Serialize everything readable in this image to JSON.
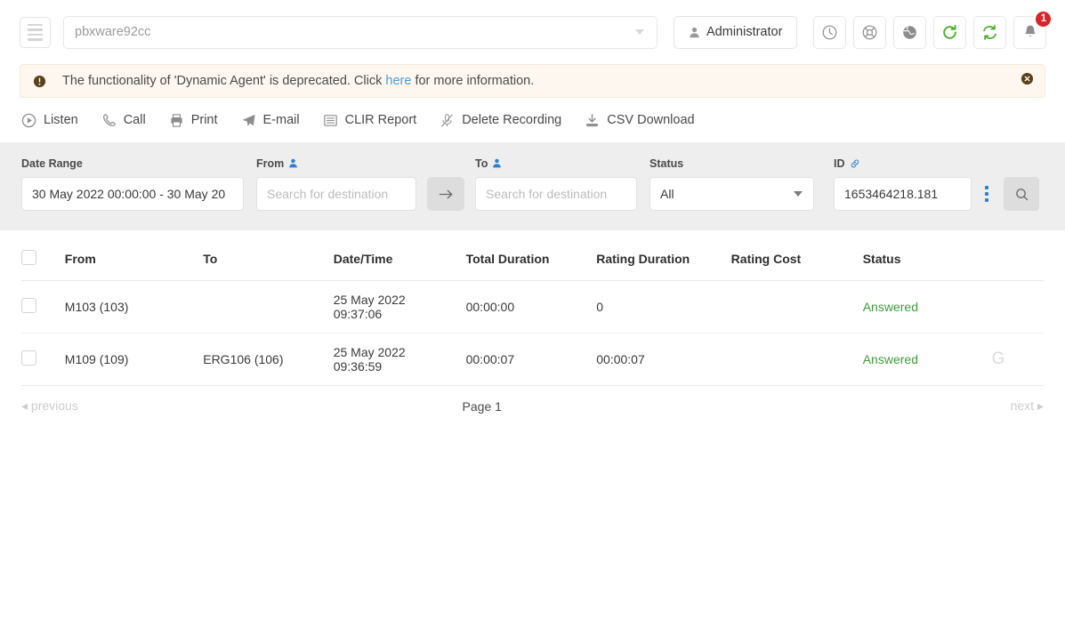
{
  "header": {
    "menu_icon": "hamburger-icon",
    "server_name": "pbxware92cc",
    "user_label": "Administrator",
    "user_icon": "user-icon",
    "icon_buttons": [
      {
        "name": "clock-icon",
        "title": "Clock"
      },
      {
        "name": "lifebuoy-icon",
        "title": "Support"
      },
      {
        "name": "globe-icon",
        "title": "Language"
      },
      {
        "name": "refresh-icon",
        "title": "Reload"
      },
      {
        "name": "sync-icon",
        "title": "Sync"
      },
      {
        "name": "bell-icon",
        "title": "Notifications"
      }
    ],
    "notification_count": "1",
    "notification_color": "#d9242a",
    "accent_green": "#4caf2f"
  },
  "alert": {
    "icon": "exclamation-circle-icon",
    "text_before": "The functionality of 'Dynamic Agent' is deprecated. Click ",
    "link_text": "here",
    "text_after": " for more information.",
    "close_icon": "close-circle-icon",
    "bg_color": "#fdf7ef",
    "link_color": "#4a9fd4"
  },
  "actions": [
    {
      "icon": "play-circle-icon",
      "label": "Listen"
    },
    {
      "icon": "phone-icon",
      "label": "Call"
    },
    {
      "icon": "printer-icon",
      "label": "Print"
    },
    {
      "icon": "paper-plane-icon",
      "label": "E-mail"
    },
    {
      "icon": "report-list-icon",
      "label": "CLIR Report"
    },
    {
      "icon": "microphone-slash-icon",
      "label": "Delete Recording"
    },
    {
      "icon": "download-icon",
      "label": "CSV Download"
    }
  ],
  "filters": {
    "date_range": {
      "label": "Date Range",
      "value": "30 May 2022 00:00:00 - 30 May 20"
    },
    "from": {
      "label": "From",
      "icon": "user-blue-icon",
      "value": "",
      "placeholder": "Search for destination"
    },
    "swap": {
      "icon": "arrow-right-icon"
    },
    "to": {
      "label": "To",
      "icon": "user-blue-icon",
      "value": "",
      "placeholder": "Search for destination"
    },
    "status": {
      "label": "Status",
      "value": "All",
      "options": [
        "All"
      ]
    },
    "id": {
      "label": "ID",
      "icon": "link-blue-icon",
      "value": "1653464218.181"
    },
    "more_icon": "vertical-dots-icon",
    "search_icon": "search-icon",
    "bg_color": "#eeeeee",
    "accent_blue": "#2f7fd1"
  },
  "table": {
    "columns": [
      "From",
      "To",
      "Date/Time",
      "Total Duration",
      "Rating Duration",
      "Rating Cost",
      "Status"
    ],
    "rows": [
      {
        "selected": false,
        "from": "M103 (103)",
        "to": "",
        "date": "25 May 2022",
        "time": "09:37:06",
        "total_duration": "00:00:00",
        "rating_duration": "0",
        "rating_cost": "",
        "status": "Answered",
        "recording_icon": ""
      },
      {
        "selected": false,
        "from": "M109 (109)",
        "to": "ERG106 (106)",
        "date": "25 May 2022",
        "time": "09:36:59",
        "total_duration": "00:00:07",
        "rating_duration": "00:00:07",
        "rating_cost": "",
        "status": "Answered",
        "recording_icon": "G"
      }
    ],
    "status_color": "#3e9c3e"
  },
  "pagination": {
    "previous": "previous",
    "page": "Page 1",
    "next": "next"
  }
}
